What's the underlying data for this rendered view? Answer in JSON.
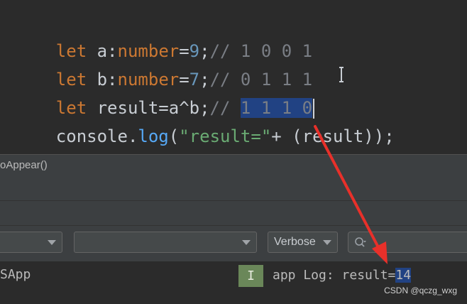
{
  "editor": {
    "line1": {
      "kw": "let",
      "name": " a:",
      "type": "number",
      "op": "=",
      "num": "9",
      "semi": ";",
      "comment": "// 1 0 0 1"
    },
    "line2": {
      "kw": "let",
      "name": " b:",
      "type": "number",
      "op": "=",
      "num": "7",
      "semi": ";",
      "comment": "// 0 1 1 1"
    },
    "line3": {
      "kw": "let",
      "name": " result=a^b;",
      "comment_prefix": "// ",
      "selected": "1 1 1 0"
    },
    "line4": {
      "obj": "console",
      "dot": ".",
      "fn": "log",
      "open": "(",
      "str": "\"result=\"",
      "rest": "+ (result));"
    }
  },
  "breadcrumb": {
    "text": "oAppear()"
  },
  "filters": {
    "level_selected": "Verbose"
  },
  "log": {
    "app": "SApp",
    "level": "I",
    "message_prefix": "app Log: result=",
    "message_value": "14"
  },
  "watermark": "CSDN @qczg_wxg",
  "colors": {
    "annotation_arrow": "#e8302a",
    "selection": "#214283",
    "info_badge": "#6a8759"
  }
}
